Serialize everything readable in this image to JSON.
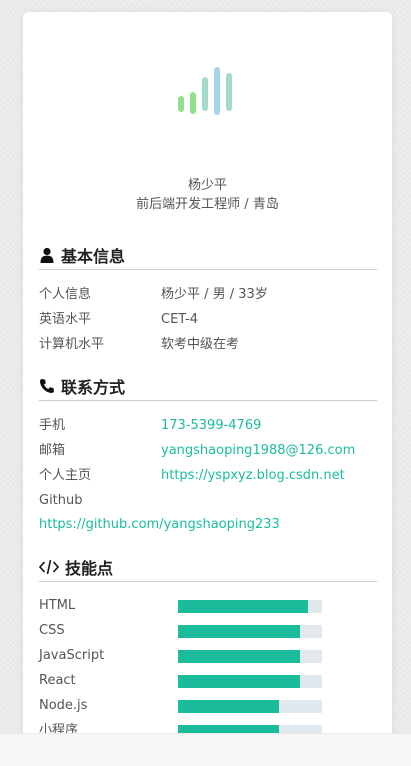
{
  "profile": {
    "name": "杨少平",
    "title": "前后端开发工程师 / 青岛"
  },
  "colors": {
    "accent": "#1abc9c",
    "logo_green": "#8fe08a",
    "logo_teal": "#a3dccb",
    "logo_blue": "#a8d4e8",
    "bar_track": "#e1e8ee"
  },
  "basic": {
    "heading": "基本信息",
    "icon": "user-icon",
    "rows": [
      {
        "label": "个人信息",
        "value": "杨少平 / 男 / 33岁"
      },
      {
        "label": "英语水平",
        "value": "CET-4"
      },
      {
        "label": "计算机水平",
        "value": "软考中级在考"
      }
    ]
  },
  "contact": {
    "heading": "联系方式",
    "icon": "phone-icon",
    "rows": [
      {
        "label": "手机",
        "value": "173-5399-4769"
      },
      {
        "label": "邮箱",
        "value": "yangshaoping1988@126.com"
      },
      {
        "label": "个人主页",
        "value": "https://yspxyz.blog.csdn.net"
      }
    ],
    "github_label": "Github",
    "github_url": "https://github.com/yangshaoping233"
  },
  "skills": {
    "heading": "技能点",
    "icon": "code-icon",
    "items": [
      {
        "name": "HTML",
        "level": 0.9
      },
      {
        "name": "CSS",
        "level": 0.85
      },
      {
        "name": "JavaScript",
        "level": 0.85
      },
      {
        "name": "React",
        "level": 0.85
      },
      {
        "name": "Node.js",
        "level": 0.7
      },
      {
        "name": "小程序",
        "level": 0.7
      }
    ]
  }
}
